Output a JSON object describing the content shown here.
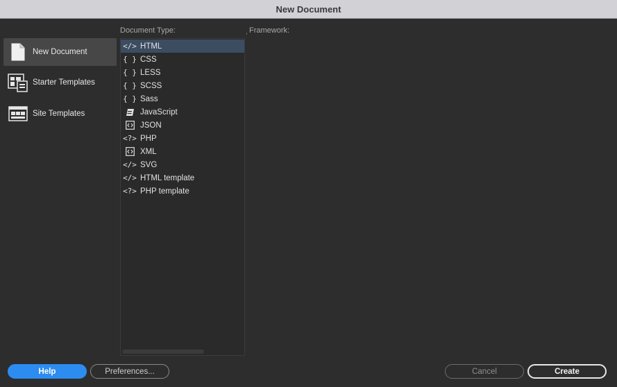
{
  "window": {
    "title": "New Document"
  },
  "categories": [
    {
      "label": "New Document",
      "icon": "document-icon",
      "selected": true
    },
    {
      "label": "Starter Templates",
      "icon": "starter-templates-icon",
      "selected": false
    },
    {
      "label": "Site Templates",
      "icon": "site-templates-icon",
      "selected": false
    }
  ],
  "document_type": {
    "header": "Document Type:",
    "items": [
      {
        "label": "HTML",
        "icon_glyph": "</>",
        "selected": true
      },
      {
        "label": "CSS",
        "icon_glyph": "{ }"
      },
      {
        "label": "LESS",
        "icon_glyph": "{ }"
      },
      {
        "label": "SCSS",
        "icon_glyph": "{ }"
      },
      {
        "label": "Sass",
        "icon_glyph": "{ }"
      },
      {
        "label": "JavaScript",
        "icon_glyph": "JS"
      },
      {
        "label": "JSON",
        "icon_glyph": "<>"
      },
      {
        "label": "PHP",
        "icon_glyph": "<?>"
      },
      {
        "label": "XML",
        "icon_glyph": "<>"
      },
      {
        "label": "SVG",
        "icon_glyph": "</>"
      },
      {
        "label": "HTML template",
        "icon_glyph": "</>"
      },
      {
        "label": "PHP template",
        "icon_glyph": "<?>"
      }
    ]
  },
  "framework": {
    "header": "Framework:"
  },
  "buttons": {
    "help": "Help",
    "preferences": "Preferences...",
    "cancel": "Cancel",
    "create": "Create"
  },
  "colors": {
    "accent": "#2d8cf0",
    "selected_row": "#3c4d62",
    "background": "#2d2d2d"
  }
}
